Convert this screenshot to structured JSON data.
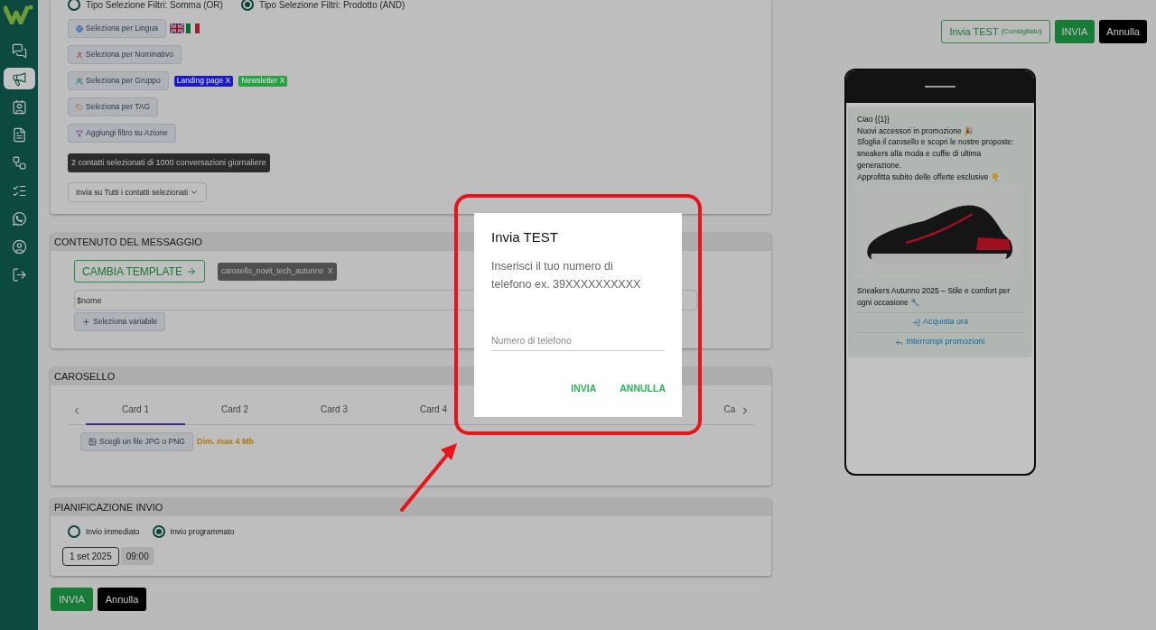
{
  "sidebar": {
    "items": [
      {
        "kind": "chats",
        "selected": false
      },
      {
        "kind": "campaigns",
        "selected": true
      },
      {
        "kind": "contacts",
        "selected": false
      },
      {
        "kind": "documents",
        "selected": false
      },
      {
        "kind": "flows",
        "selected": false
      },
      {
        "kind": "tasks",
        "selected": false
      },
      {
        "kind": "whatsapp",
        "selected": false
      },
      {
        "kind": "account",
        "selected": false
      },
      {
        "kind": "logout",
        "selected": false
      }
    ]
  },
  "filters": {
    "radios": [
      {
        "label": "Tipo Selezione Filtri: Somma (OR)",
        "selected": false
      },
      {
        "label": "Tipo Selezione Filtri: Prodotto (AND)",
        "selected": true
      }
    ],
    "buttons": [
      {
        "kind": "language",
        "label": "Seleziona per Lingua"
      },
      {
        "kind": "name",
        "label": "Seleziona per Nominativo"
      },
      {
        "kind": "group",
        "label": "Seleziona per Gruppo"
      },
      {
        "kind": "tag",
        "label": "Seleziona per TAG"
      },
      {
        "kind": "action",
        "label": "Aggiungi filtro su Azione"
      }
    ],
    "group_tags": [
      {
        "label": "Landing page X",
        "color": "#1a1ac8"
      },
      {
        "label": "Newsletter X",
        "color": "#26a340"
      }
    ],
    "summary": "2 contatti selezionati di 1000 conversazioni giornaliere",
    "send_scope": "Invia su Tutti i contatti selezionati"
  },
  "message_content": {
    "title": "CONTENUTO DEL MESSAGGIO",
    "change_template": "CAMBIA TEMPLATE",
    "template": "carosello_novit_tech_autunno",
    "template_remove": "X",
    "variable_value": "$nome",
    "add_variable": "Seleziona variabile"
  },
  "carousel": {
    "title": "CAROSELLO",
    "tabs": [
      {
        "label": "Card 1",
        "selected": true
      },
      {
        "label": "Card 2",
        "selected": false
      },
      {
        "label": "Card 3",
        "selected": false
      },
      {
        "label": "Card 4",
        "selected": false
      },
      {
        "label": "Ca",
        "selected": false
      }
    ],
    "file_button": "Scegli un file JPG o PNG",
    "file_hint": "Dim. max 4 Mb"
  },
  "scheduling": {
    "title": "PIANIFICAZIONE INVIO",
    "radios": [
      {
        "label": "Invio immediato",
        "selected": false
      },
      {
        "label": "Invio programmato",
        "selected": true
      }
    ],
    "date": "1 set 2025",
    "time": "09:00"
  },
  "footer_buttons": {
    "send": "INVIA",
    "cancel": "Annulla"
  },
  "header_actions": {
    "test": "Invia TEST",
    "test_note": "(Consigliato)",
    "send": "INVIA",
    "cancel": "Annulla"
  },
  "preview": {
    "message": "Ciao {{1}}\nNuovi accessori in promozione 🎉\nSfoglia il carosello e scopri le nostre proposte: sneakers alla moda e cuffie di ultima generazione.\nApprofitta subito delle offerte esclusive 👇",
    "caption": "Sneakers Autunno 2025 – Stile e comfort per ogni occasione 🔧",
    "buttons": [
      {
        "kind": "link",
        "label": "Acquista ora"
      },
      {
        "kind": "reply",
        "label": "Interrompi promozioni"
      }
    ]
  },
  "dialog": {
    "title": "Invia TEST",
    "text": "Inserisci il tuo numero di telefono ex. 39XXXXXXXXXX",
    "placeholder": "Numero di telefono",
    "buttons": [
      "INVIA",
      "ANNULLA"
    ]
  }
}
